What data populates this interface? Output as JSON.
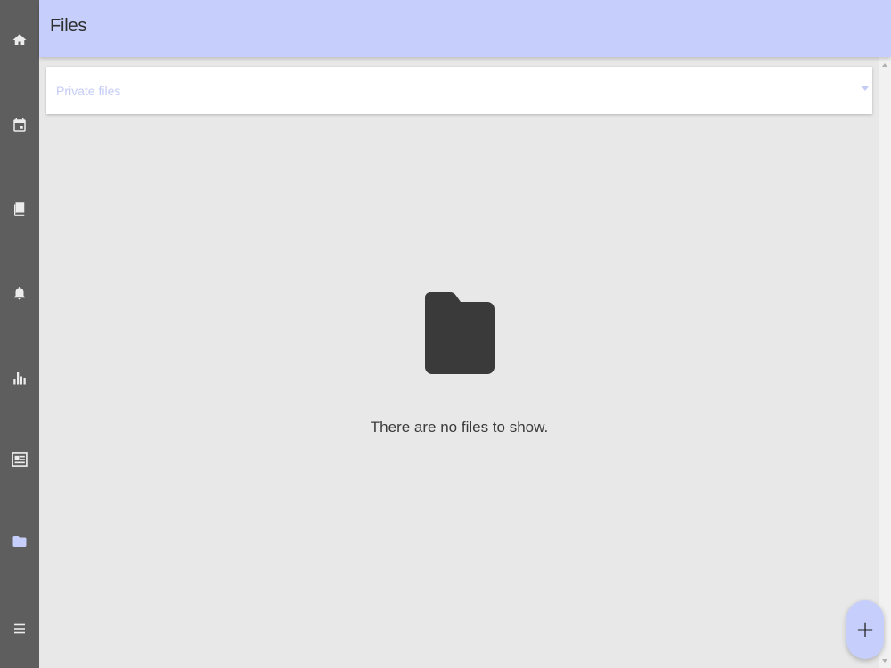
{
  "header": {
    "title": "Files"
  },
  "sidebar": {
    "items": [
      {
        "icon": "home-icon",
        "active": false
      },
      {
        "icon": "calendar-icon",
        "active": false
      },
      {
        "icon": "book-icon",
        "active": false
      },
      {
        "icon": "bell-icon",
        "active": false
      },
      {
        "icon": "bar-chart-icon",
        "active": false
      },
      {
        "icon": "newspaper-icon",
        "active": false
      },
      {
        "icon": "folder-icon",
        "active": true
      },
      {
        "icon": "menu-icon",
        "active": false
      }
    ]
  },
  "file_filter": {
    "selected": "Private files"
  },
  "empty_state": {
    "message": "There are no files to show.",
    "icon": "folder-icon"
  },
  "fab": {
    "label": "+",
    "icon": "plus-icon"
  },
  "colors": {
    "sidebar_bg": "#5e5e5e",
    "sidebar_icon": "#ececec",
    "sidebar_active": "#c6cffb",
    "header_bg": "#c6cffb",
    "content_bg": "#e8e8e8",
    "placeholder_text": "#c4cbf5",
    "empty_icon": "#3a3a3a"
  }
}
